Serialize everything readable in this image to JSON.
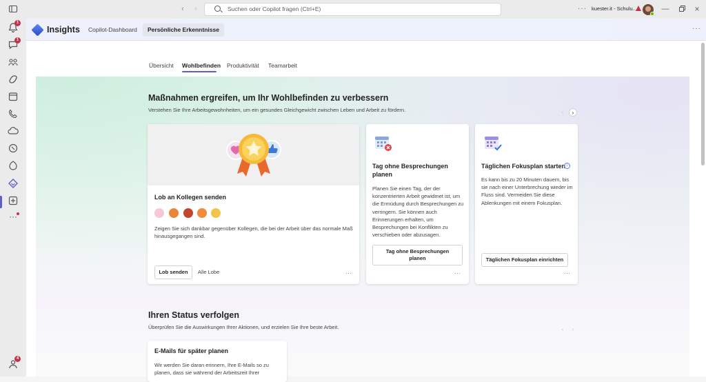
{
  "titlebar": {
    "search_placeholder": "Suchen oder Copilot fragen (Ctrl+E)",
    "user_label": "kuester.it - Schulu...",
    "more_label": "···"
  },
  "rail": {
    "activity_badge": "1",
    "chat_badge": "1",
    "bottom_badge": "4"
  },
  "app": {
    "title": "Insights",
    "tabs": [
      {
        "label": "Copilot-Dashboard"
      },
      {
        "label": "Persönliche Erkenntnisse"
      }
    ],
    "more_label": "···"
  },
  "subtabs": [
    {
      "label": "Übersicht"
    },
    {
      "label": "Wohlbefinden"
    },
    {
      "label": "Produktivität"
    },
    {
      "label": "Teamarbeit"
    }
  ],
  "section1": {
    "title": "Maßnahmen ergreifen, um Ihr Wohlbefinden zu verbessern",
    "subtitle": "Verstehen Sie Ihre Arbeitsgewohnheiten, um ein gesundes Gleichgewicht zwischen Leben und Arbeit zu fördern."
  },
  "cards": [
    {
      "title": "Lob an Kollegen senden",
      "text": "Zeigen Sie sich dankbar gegenüber Kollegen, die bei der Arbeit über das normale Maß hinausgegangen sind.",
      "primary": "Lob senden",
      "secondary": "Alle Lobe",
      "more": "···"
    },
    {
      "title": "Tag ohne Besprechungen planen",
      "text": "Planen Sie einen Tag, der der konzentrierten Arbeit gewidmet ist, um die Ermüdung durch Besprechungen zu verringern. Sie können auch Erinnerungen erhalten, um Besprechungen bei Konflikten zu verschieben oder abzusagen.",
      "primary": "Tag ohne Besprechungen planen",
      "more": "···"
    },
    {
      "title": "Täglichen Fokusplan starten",
      "text": "Es kann bis zu 20 Minuten dauern, bis sie nach einer Unterbrechung wieder im Fluss sind. Vermeiden Sie diese Ablenkungen mit einem Fokusplan.",
      "primary": "Täglichen Fokusplan einrichten",
      "more": "···"
    }
  ],
  "section2": {
    "title": "Ihren Status verfolgen",
    "subtitle": "Überprüfen Sie die Auswirkungen Ihrer Aktionen, und erzielen Sie Ihre beste Arbeit."
  },
  "card4": {
    "title": "E-Mails für später planen",
    "text": "Wir werden Sie daran erinnern, Ihre E-Mails so zu planen, dass sie während der Arbeitszeit Ihrer"
  },
  "colors": {
    "accent": "#5b5fc7",
    "badge": "#c4314b"
  }
}
